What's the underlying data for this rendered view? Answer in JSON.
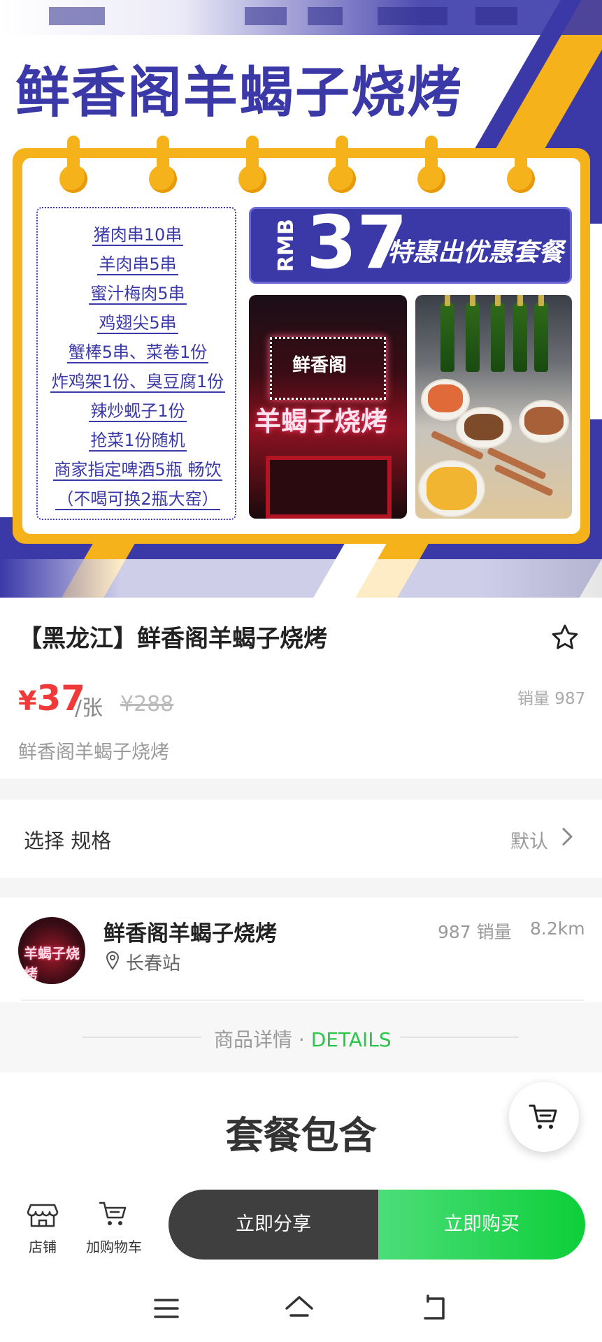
{
  "banner": {
    "title": "鲜香阁羊蝎子烧烤",
    "menu_items": [
      "猪肉串10串",
      "羊肉串5串",
      "蜜汁梅肉5串",
      "鸡翅尖5串",
      "蟹棒5串、菜卷1份",
      "炸鸡架1份、臭豆腐1份",
      "辣炒蚬子1份",
      "抢菜1份随机",
      "商家指定啤酒5瓶 畅饮",
      "（不喝可换2瓶大窑）"
    ],
    "price_currency": "RMB",
    "price_value": "37",
    "price_tagline": "特惠出优惠套餐",
    "store_photo_sign": "鲜香阁",
    "store_photo_big": "羊蝎子烧烤"
  },
  "product": {
    "title": "【黑龙江】鲜香阁羊蝎子烧烤",
    "price_symbol": "¥",
    "price": "37",
    "price_unit": "/张",
    "original_price": "¥288",
    "sold_label": "销量 987",
    "subtitle": "鲜香阁羊蝎子烧烤"
  },
  "spec": {
    "label": "选择 规格",
    "value": "默认"
  },
  "shop": {
    "name": "鲜香阁羊蝎子烧烤",
    "location": "长春站",
    "sold": "987 销量",
    "distance": "8.2km",
    "avatar_text": "羊蝎子烧烤"
  },
  "details": {
    "label_cn": "商品详情 · ",
    "label_en": "DETAILS"
  },
  "package": {
    "title": "套餐包含"
  },
  "bottom_bar": {
    "store_label": "店铺",
    "cart_label": "加购物车",
    "share_label": "立即分享",
    "buy_label": "立即购买"
  },
  "colors": {
    "brand_blue": "#3b39a8",
    "brand_yellow": "#f6b21b",
    "price_red": "#f03a3a",
    "buy_green": "#0ccf38"
  },
  "icons": [
    "star-icon",
    "chevron-right-icon",
    "location-pin-icon",
    "cart-icon",
    "store-icon",
    "menu-icon",
    "home-icon",
    "back-icon"
  ]
}
